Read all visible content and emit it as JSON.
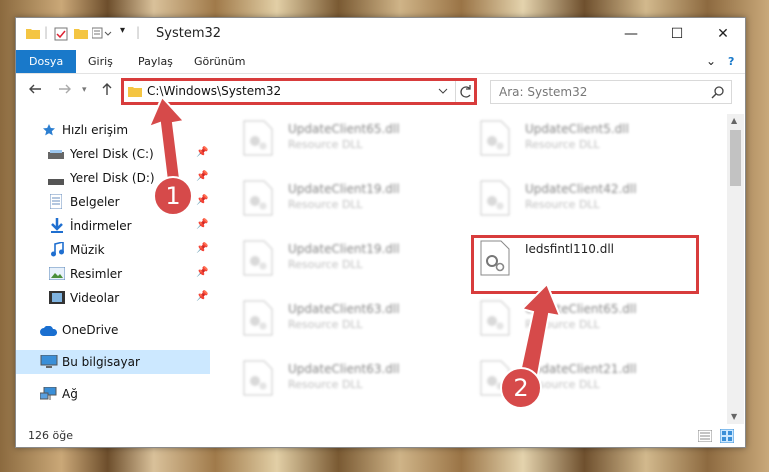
{
  "window": {
    "title": "System32",
    "ribbon_tabs": [
      "Dosya",
      "Giriş",
      "Paylaş",
      "Görünüm"
    ],
    "controls": {
      "minimize": "—",
      "maximize": "☐",
      "close": "✕"
    },
    "chevron": "⌄",
    "help": "?"
  },
  "nav": {
    "address": "C:\\Windows\\System32",
    "search_placeholder": "Ara: System32"
  },
  "sidebar": {
    "quick_access": "Hızlı erişim",
    "items": [
      {
        "label": "Yerel Disk (C:)",
        "icon": "drive-icon"
      },
      {
        "label": "Yerel Disk (D:)",
        "icon": "drive-icon"
      },
      {
        "label": "Belgeler",
        "icon": "documents-icon"
      },
      {
        "label": "İndirmeler",
        "icon": "download-icon"
      },
      {
        "label": "Müzik",
        "icon": "music-icon"
      },
      {
        "label": "Resimler",
        "icon": "pictures-icon"
      },
      {
        "label": "Videolar",
        "icon": "videos-icon"
      }
    ],
    "onedrive": "OneDrive",
    "this_pc": "Bu bilgisayar",
    "network": "Ağ"
  },
  "files": [
    {
      "name": "UpdateClient65.dll",
      "type": "Resource DLL"
    },
    {
      "name": "UpdateClient5.dll",
      "type": "Resource DLL"
    },
    {
      "name": "UpdateClient19.dll",
      "type": "Resource DLL"
    },
    {
      "name": "UpdateClient42.dll",
      "type": "Resource DLL"
    },
    {
      "name": "UpdateClient19.dll",
      "type": "Resource DLL"
    },
    {
      "name": "Iedsfintl110.dll",
      "type": ""
    },
    {
      "name": "UpdateClient63.dll",
      "type": "Resource DLL"
    },
    {
      "name": "UpdateClient65.dll",
      "type": "Resource DLL"
    },
    {
      "name": "UpdateClient63.dll",
      "type": "Resource DLL"
    },
    {
      "name": "UpdateClient21.dll",
      "type": "Resource DLL"
    }
  ],
  "status": {
    "count": "126 öğe"
  },
  "annotations": {
    "callout_1": "1",
    "callout_2": "2"
  },
  "colors": {
    "accent": "#1979ca",
    "highlight": "#d83c3c",
    "callout_fill": "#d64a4a"
  }
}
